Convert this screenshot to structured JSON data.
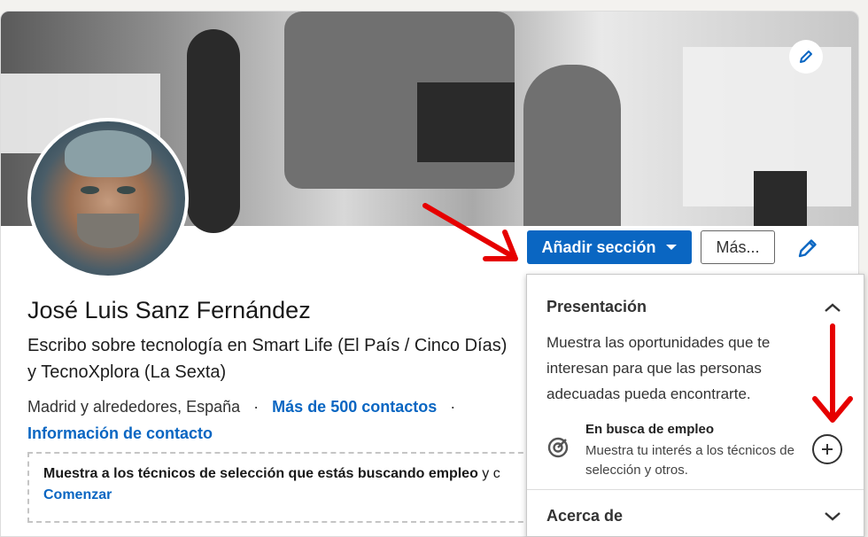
{
  "profile": {
    "name": "José Luis Sanz Fernández",
    "headline_line1": "Escribo sobre tecnología en Smart Life (El País / Cinco Días)",
    "headline_line2": "y TecnoXplora (La Sexta)",
    "location": "Madrid y alrededores, España",
    "separator": "·",
    "connections": "Más de 500 contactos",
    "contact_info": "Información de contacto"
  },
  "open_to_work": {
    "text_bold": "Muestra a los técnicos de selección que estás buscando empleo",
    "text_rest": " y c",
    "link": "Comenzar"
  },
  "actions": {
    "add_section": "Añadir sección",
    "more": "Más..."
  },
  "dropdown": {
    "section_title": "Presentación",
    "description": "Muestra las oportunidades que te interesan para que las personas adecuadas pueda encontrarte.",
    "item_title": "En busca de empleo",
    "item_description": "Muestra tu interés a los técnicos de selección y otros.",
    "next_section": "Acerca de"
  },
  "colors": {
    "primary": "#0a66c2",
    "annotation_arrow": "#e60000"
  },
  "icons": [
    "pencil-icon",
    "caret-down-icon",
    "chevron-up-icon",
    "chevron-down-icon",
    "target-icon",
    "plus-icon"
  ]
}
